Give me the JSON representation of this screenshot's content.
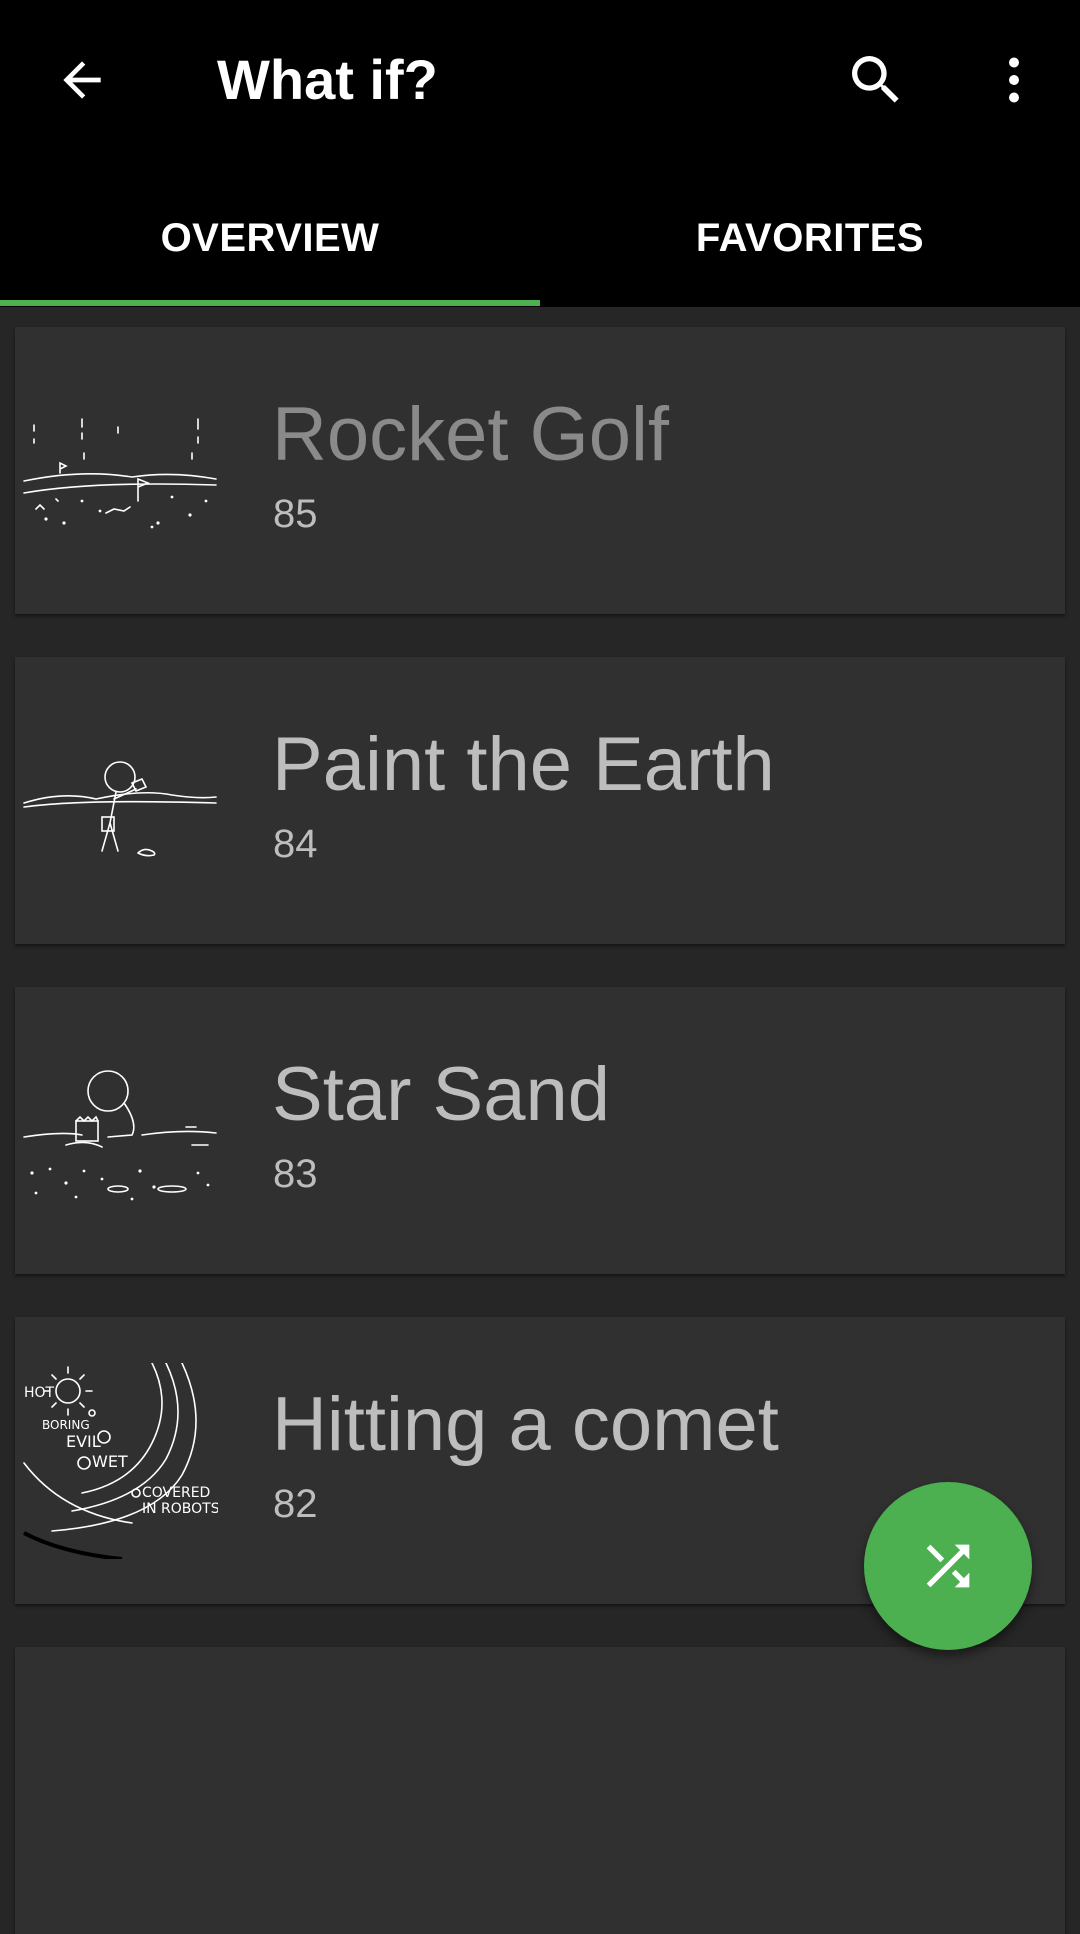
{
  "toolbar": {
    "title": "What if?",
    "back_icon": "arrow-back-icon",
    "search_icon": "search-icon",
    "more_icon": "more-vert-icon"
  },
  "tabs": [
    {
      "label": "OVERVIEW",
      "selected": true
    },
    {
      "label": "FAVORITES",
      "selected": false
    }
  ],
  "articles": [
    {
      "title": "Rocket Golf",
      "number": "85"
    },
    {
      "title": "Paint the Earth",
      "number": "84"
    },
    {
      "title": "Star Sand",
      "number": "83"
    },
    {
      "title": "Hitting a comet",
      "number": "82",
      "thumb_text": [
        "HOT",
        "BORING",
        "EVIL",
        "WET",
        "COVERED",
        "IN ROBOTS"
      ]
    }
  ],
  "fab": {
    "icon": "shuffle-icon"
  },
  "colors": {
    "accent": "#4caf50",
    "background": "#262626",
    "card": "#303030",
    "appbar": "#000000"
  }
}
